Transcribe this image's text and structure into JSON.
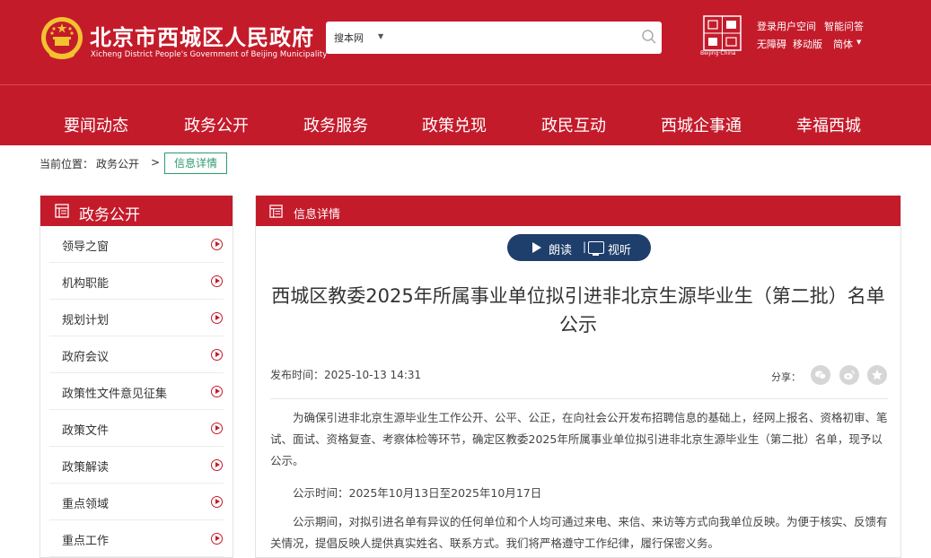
{
  "header": {
    "site_title": "北京市西城区人民政府",
    "site_subtitle": "Xicheng District People's Government of Beijing Municipality",
    "search": {
      "scope": "搜本网",
      "placeholder": ""
    },
    "capital_caption": "Beijing·China",
    "links": {
      "login": "登录用户空间",
      "smart_qa": "智能问答",
      "accessibility": "无障碍",
      "mobile": "移动版",
      "language": "简体"
    },
    "colors": {
      "brand_red": "#c41b2b",
      "accent_green": "#2e9a6d",
      "listen_navy": "#1e3e6b"
    }
  },
  "nav": {
    "items": [
      "要闻动态",
      "政务公开",
      "政务服务",
      "政策兑现",
      "政民互动",
      "西城企事通",
      "幸福西城"
    ]
  },
  "breadcrumb": {
    "prefix": "当前位置：",
    "section": "政务公开",
    "separator": ">",
    "current": "信息详情"
  },
  "sidebar": {
    "title": "政务公开",
    "icon": "document-icon",
    "items": [
      {
        "label": "领导之窗"
      },
      {
        "label": "机构职能"
      },
      {
        "label": "规划计划"
      },
      {
        "label": "政府会议"
      },
      {
        "label": "政策性文件意见征集"
      },
      {
        "label": "政策文件"
      },
      {
        "label": "政策解读"
      },
      {
        "label": "重点领域"
      },
      {
        "label": "重点工作"
      }
    ]
  },
  "content": {
    "header_title": "信息详情",
    "listen": {
      "read": "朗读",
      "separator": "|",
      "watch": "视听"
    },
    "title": "西城区教委2025年所属事业单位拟引进非北京生源毕业生（第二批）名单公示",
    "publish_time": "发布时间：2025-10-13 14:31",
    "share_label": "分享：",
    "share_icons": [
      "wechat-icon",
      "weibo-icon",
      "favorite-icon"
    ],
    "paragraphs": [
      "为确保引进非北京生源毕业生工作公开、公平、公正，在向社会公开发布招聘信息的基础上，经网上报名、资格初审、笔试、面试、资格复查、考察体检等环节，确定区教委2025年所属事业单位拟引进非北京生源毕业生（第二批）名单，现予以公示。",
      "公示时间：2025年10月13日至2025年10月17日",
      "公示期间，对拟引进名单有异议的任何单位和个人均可通过来电、来信、来访等方式向我单位反映。为便于核实、反馈有关情况，提倡反映人提供真实姓名、联系方式。我们将严格遵守工作纪律，履行保密义务。"
    ]
  }
}
